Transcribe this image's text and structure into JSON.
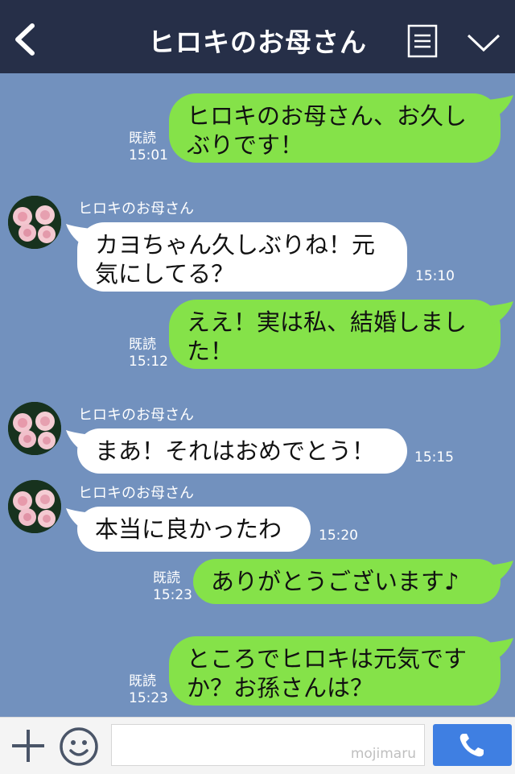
{
  "header": {
    "title": "ヒロキのお母さん"
  },
  "messages": [
    {
      "from": "me",
      "text": "ヒロキのお母さん、お久しぶりです！",
      "lines": [
        "ヒロキのお母さん、お久し",
        "ぶりです！"
      ],
      "read_label": "既読",
      "time": "15:01"
    },
    {
      "from": "them",
      "sender": "ヒロキのお母さん",
      "lines": [
        "カヨちゃん久しぶりね！元",
        "気にしてる？"
      ],
      "time": "15:10"
    },
    {
      "from": "me",
      "lines": [
        "ええ！実は私、結婚しまし",
        "た！"
      ],
      "read_label": "既読",
      "time": "15:12"
    },
    {
      "from": "them",
      "sender": "ヒロキのお母さん",
      "lines": [
        "まあ！それはおめでとう！"
      ],
      "time": "15:15"
    },
    {
      "from": "them",
      "sender": "ヒロキのお母さん",
      "lines": [
        "本当に良かったわ"
      ],
      "time": "15:20"
    },
    {
      "from": "me",
      "lines": [
        "ありがとうございます♪"
      ],
      "read_label": "既読",
      "time": "15:23"
    },
    {
      "from": "me",
      "lines": [
        "ところでヒロキは元気です",
        "か？お孫さんは？"
      ],
      "read_label": "既読",
      "time": "15:23"
    }
  ],
  "footer": {
    "input_value": "",
    "watermark": "mojimaru"
  },
  "colors": {
    "header_bg": "#262f48",
    "chat_bg": "#7291be",
    "my_bubble": "#85e249",
    "their_bubble": "#ffffff",
    "call_button": "#3f7fe2"
  }
}
